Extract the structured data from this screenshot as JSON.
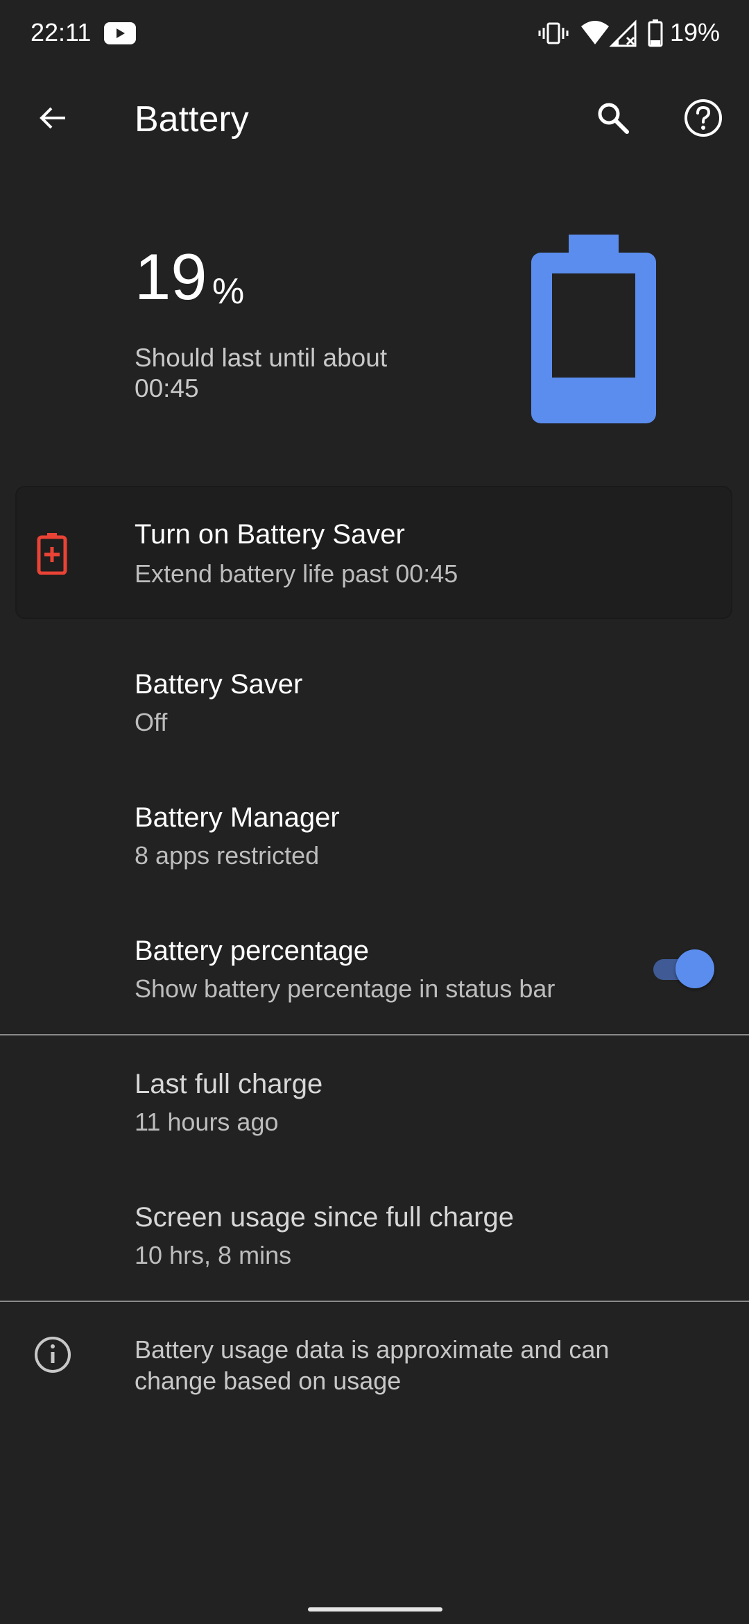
{
  "status_bar": {
    "time": "22:11",
    "battery_text": "19%",
    "icons": [
      "youtube-icon",
      "vibrate-icon",
      "wifi-icon",
      "signal-icon",
      "battery-icon"
    ]
  },
  "app_bar": {
    "title": "Battery",
    "icons": [
      "back-arrow-icon",
      "search-icon",
      "help-icon"
    ]
  },
  "battery_header": {
    "percent": "19",
    "percent_symbol": "%",
    "estimate": "Should last until about 00:45",
    "level_fraction": 0.19,
    "battery_color": "#5b8def"
  },
  "saver_suggestion": {
    "title": "Turn on Battery Saver",
    "subtitle": "Extend battery life past 00:45",
    "icon": "battery-plus-icon",
    "icon_color": "#ea4335"
  },
  "items": [
    {
      "title": "Battery Saver",
      "subtitle": "Off"
    },
    {
      "title": "Battery Manager",
      "subtitle": "8 apps restricted"
    },
    {
      "title": "Battery percentage",
      "subtitle": "Show battery percentage in status bar",
      "toggle_on": true
    }
  ],
  "usage": [
    {
      "title": "Last full charge",
      "subtitle": "11 hours ago"
    },
    {
      "title": "Screen usage since full charge",
      "subtitle": "10 hrs, 8 mins"
    }
  ],
  "footer": {
    "text": "Battery usage data is approximate and can change based on usage",
    "icon": "info-icon"
  },
  "colors": {
    "background": "#222222",
    "accent": "#5b8def"
  }
}
